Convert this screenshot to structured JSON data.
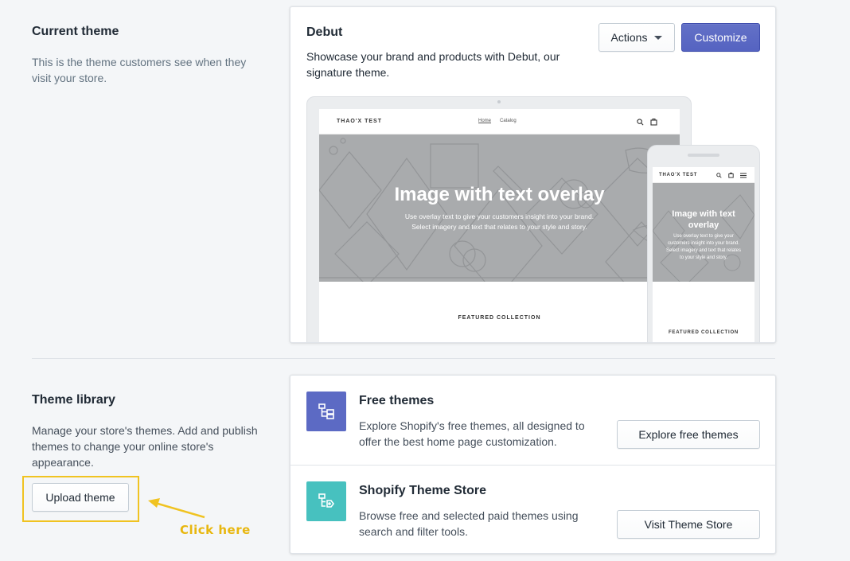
{
  "current_theme": {
    "title": "Current theme",
    "description": "This is the theme customers see when they visit your store.",
    "theme_name": "Debut",
    "theme_description": "Showcase your brand and products with Debut, our signature theme.",
    "actions_label": "Actions",
    "customize_label": "Customize"
  },
  "preview": {
    "store_name": "THAO'X TEST",
    "nav": [
      "Home",
      "Catalog"
    ],
    "hero_title": "Image with text overlay",
    "hero_sub_line1": "Use overlay text to give your customers insight into your brand.",
    "hero_sub_line2": "Select imagery and text that relates to your style and story.",
    "featured": "FEATURED COLLECTION",
    "mobile_hero_title_line1": "Image with text",
    "mobile_hero_title_line2": "overlay",
    "mobile_sub": [
      "Use overlay text to give your",
      "customers insight into your brand.",
      "Select imagery and text that relates",
      "to your style and story."
    ]
  },
  "theme_library": {
    "title": "Theme library",
    "description": "Manage your store's themes. Add and publish themes to change your online store's appearance.",
    "upload_label": "Upload theme",
    "annotation": "Click here",
    "items": [
      {
        "title": "Free themes",
        "description": "Explore Shopify's free themes, all designed to offer the best home page customization.",
        "button": "Explore free themes",
        "icon_color": "#5c6ac4"
      },
      {
        "title": "Shopify Theme Store",
        "description": "Browse free and selected paid themes using search and filter tools.",
        "button": "Visit Theme Store",
        "icon_color": "#47c1bf"
      }
    ]
  },
  "colors": {
    "primary": "#5c6ac4",
    "teal": "#47c1bf",
    "highlight": "#f0c321",
    "background": "#f4f6f8"
  }
}
